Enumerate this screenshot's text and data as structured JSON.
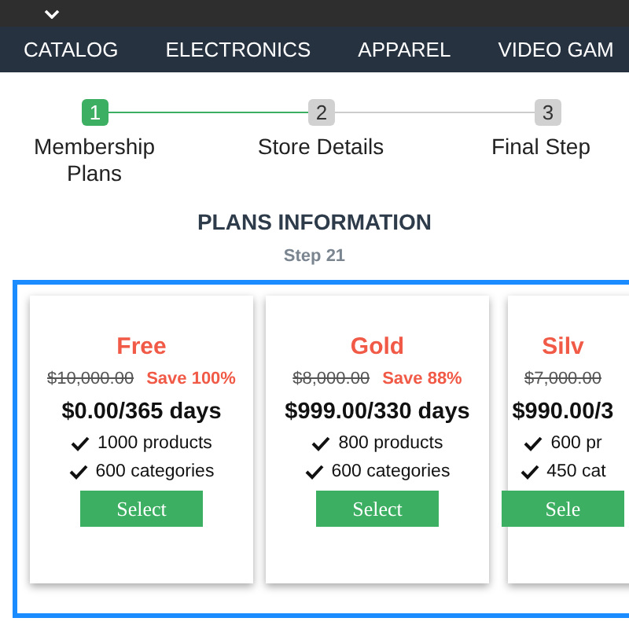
{
  "nav": {
    "items": [
      "CATALOG",
      "ELECTRONICS",
      "APPAREL",
      "VIDEO GAM"
    ]
  },
  "stepper": [
    {
      "number": "1",
      "label": "Membership Plans",
      "completed": true
    },
    {
      "number": "2",
      "label": "Store Details",
      "completed": false
    },
    {
      "number": "3",
      "label": "Final Step",
      "completed": false
    }
  ],
  "heading": "PLANS INFORMATION",
  "subheading": "Step 21",
  "plans": [
    {
      "name": "Free",
      "old_price": "$10,000.00",
      "save": "Save 100%",
      "price": "$0.00/365 days",
      "features": [
        "1000 products",
        "600 categories"
      ],
      "button": "Select"
    },
    {
      "name": "Gold",
      "old_price": "$8,000.00",
      "save": "Save 88%",
      "price": "$999.00/330 days",
      "features": [
        "800 products",
        "600 categories"
      ],
      "button": "Select"
    },
    {
      "name": "Silv",
      "old_price": "$7,000.00",
      "price": "$990.00/3",
      "features": [
        "600 pr",
        "450 cat"
      ],
      "button": "Sele"
    }
  ]
}
